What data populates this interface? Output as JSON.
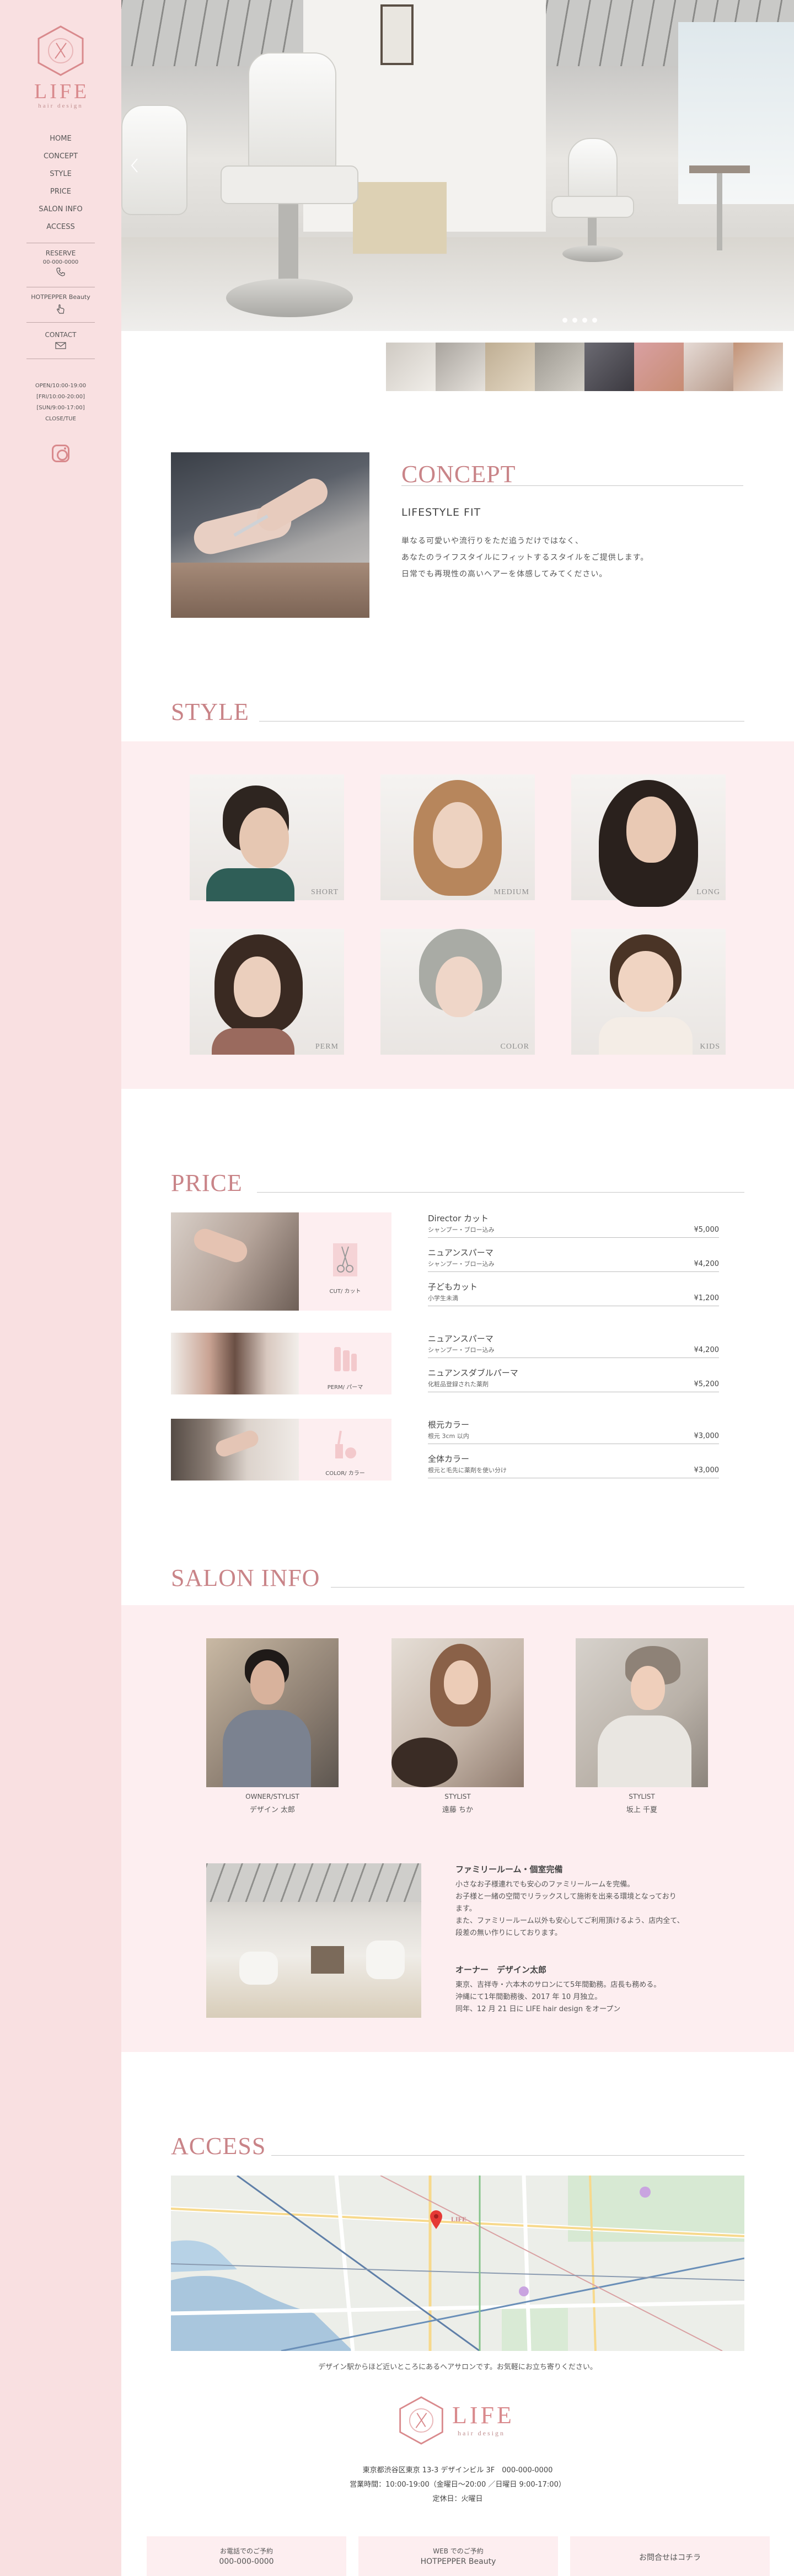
{
  "sidebar": {
    "brand": "LIFE",
    "brand_sub": "hair design",
    "nav": [
      "HOME",
      "CONCEPT",
      "STYLE",
      "PRICE",
      "SALON INFO",
      "ACCESS"
    ],
    "reserve_label": "RESERVE",
    "reserve_phone": "00-000-0000",
    "hotpepper_label": "HOTPEPPER Beauty",
    "contact_label": "CONTACT",
    "hours": [
      "OPEN/10:00-19:00",
      "[FRI/10:00-20:00]",
      "[SUN/9:00-17:00]",
      "CLOSE/TUE"
    ]
  },
  "concept": {
    "title": "CONCEPT",
    "subtitle": "LIFESTYLE FIT",
    "lines": [
      "単なる可愛いや流行りをただ追うだけではなく、",
      "あなたのライフスタイルにフィットするスタイルをご提供します。",
      "日常でも再現性の高いヘアーを体感してみてください。"
    ]
  },
  "style": {
    "title": "STYLE",
    "cards": [
      "SHORT",
      "MEDIUM",
      "LONG",
      "PERM",
      "COLOR",
      "KIDS"
    ]
  },
  "price": {
    "title": "PRICE",
    "groups": [
      {
        "tag": "CUT/ カット",
        "items": [
          {
            "name": "Director カット",
            "desc": "シャンプー・ブロー込み",
            "price": "¥5,000"
          },
          {
            "name": "ニュアンスパーマ",
            "desc": "シャンプー・ブロー込み",
            "price": "¥4,200"
          },
          {
            "name": "子どもカット",
            "desc": "小学生未満",
            "price": "¥1,200"
          }
        ]
      },
      {
        "tag": "PERM/ パーマ",
        "items": [
          {
            "name": "ニュアンスパーマ",
            "desc": "シャンプー・ブロー込み",
            "price": "¥4,200"
          },
          {
            "name": "ニュアンスダブルパーマ",
            "desc": "化粧品登録された薬剤",
            "price": "¥5,200"
          }
        ]
      },
      {
        "tag": "COLOR/ カラー",
        "items": [
          {
            "name": "根元カラー",
            "desc": "根元 3cm 以内",
            "price": "¥3,000"
          },
          {
            "name": "全体カラー",
            "desc": "根元と毛先に薬剤を使い分け",
            "price": "¥3,000"
          }
        ]
      }
    ]
  },
  "salon_info": {
    "title": "SALON INFO",
    "staff": [
      {
        "role": "OWNER/STYLIST",
        "name": "デザイン 太郎"
      },
      {
        "role": "STYLIST",
        "name": "遠藤 ちか"
      },
      {
        "role": "STYLIST",
        "name": "坂上 千夏"
      }
    ],
    "room_heading": "ファミリールーム・個室完備",
    "room_lines": [
      "小さなお子様連れでも安心のファミリールームを完備。",
      "お子様と一緒の空間でリラックスして施術を出来る環境となっており",
      "ます。",
      "また、ファミリールーム以外も安心してご利用頂けるよう、店内全て、",
      "段差の無い作りにしております。"
    ],
    "owner_heading": "オーナー　デザイン太郎",
    "owner_lines": [
      "東京、吉祥寺・六本木のサロンにて5年間勤務。店長も務める。",
      "沖縄にて1年間勤務後、2017 年 10 月独立。",
      "同年、12 月 21 日に LIFE hair design をオープン"
    ]
  },
  "access": {
    "title": "ACCESS",
    "note": "デザイン駅からほど近いところにあるヘアサロンです。お気軽にお立ち寄りください。",
    "brand": "LIFE",
    "brand_sub": "hair design",
    "address": "東京都渋谷区東京 13-3 デザインビル 3F　000-000-0000",
    "hours": "営業時間：10:00-19:00（金曜日～20:00 ／日曜日 9:00-17:00）",
    "closed": "定休日：火曜日"
  },
  "footer": {
    "buttons": [
      {
        "l1": "お電話でのご予約",
        "l2": "000-000-0000"
      },
      {
        "l1": "WEB でのご予約",
        "l2": "HOTPEPPER Beauty"
      },
      {
        "l1": "",
        "l2": "お問合せはコチラ"
      }
    ]
  },
  "colors": {
    "accent": "#d98a8d",
    "sidebar_bg": "#f9e0e1",
    "band_bg": "#fdeef0"
  }
}
